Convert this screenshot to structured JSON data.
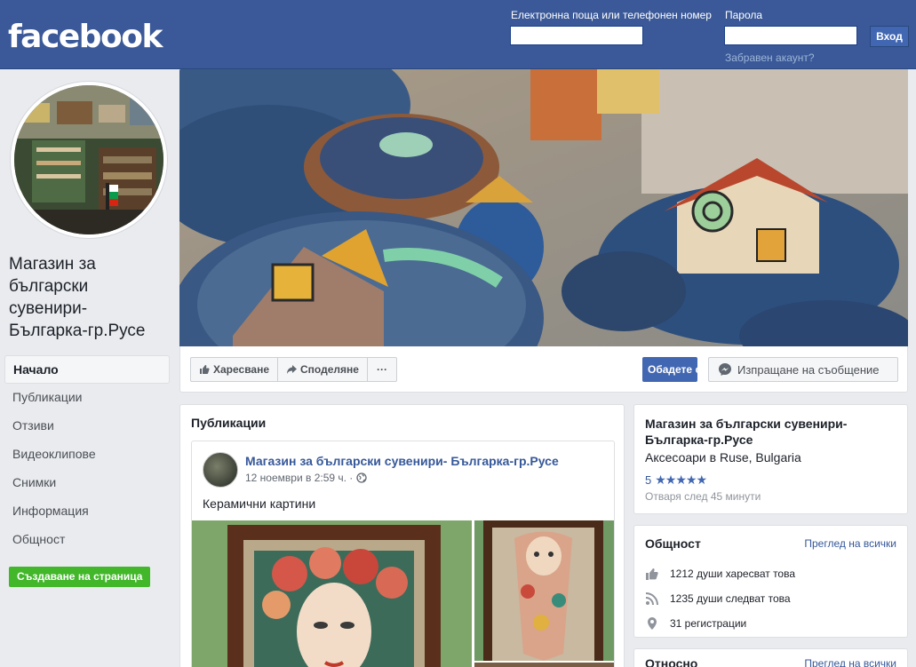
{
  "header": {
    "logo": "facebook",
    "email_label": "Електронна поща или телефонен номер",
    "password_label": "Парола",
    "email_value": "",
    "password_value": "",
    "login_button": "Вход",
    "forgot_link": "Забравен акаунт?"
  },
  "page": {
    "name": "Магазин за български сувенири- Българка-гр.Русе"
  },
  "sidebar": {
    "items": [
      {
        "label": "Начало",
        "active": true
      },
      {
        "label": "Публикации"
      },
      {
        "label": "Отзиви"
      },
      {
        "label": "Видеоклипове"
      },
      {
        "label": "Снимки"
      },
      {
        "label": "Информация"
      },
      {
        "label": "Общност"
      }
    ],
    "create_page": "Създаване на страница"
  },
  "actions": {
    "like": "Харесване",
    "share": "Споделяне",
    "more": "···",
    "follow": "Обадете се",
    "message": "Изпращане на съобщение"
  },
  "posts": {
    "title": "Публикации",
    "post": {
      "author": "Магазин за български сувенири- Българка-гр.Русе",
      "time": "12 ноември в 2:59 ч. ·",
      "text": "Керамични картини"
    }
  },
  "about": {
    "title": "Магазин за български сувенири- Българка-гр.Русе",
    "category": "Аксесоари в Ruse, Bulgaria",
    "rating": "5",
    "stars": "★★★★★",
    "opens": "Отваря след 45 минути"
  },
  "community": {
    "title": "Общност",
    "see_all": "Преглед на всички",
    "likes": "1212 души харесват това",
    "follows": "1235 души следват това",
    "checkins": "31 регистрации"
  },
  "about_section": {
    "title": "Относно",
    "see_all": "Преглед на всички"
  },
  "colors": {
    "brand": "#3b5998",
    "button_blue": "#4267b2",
    "create_green": "#42b72a"
  }
}
